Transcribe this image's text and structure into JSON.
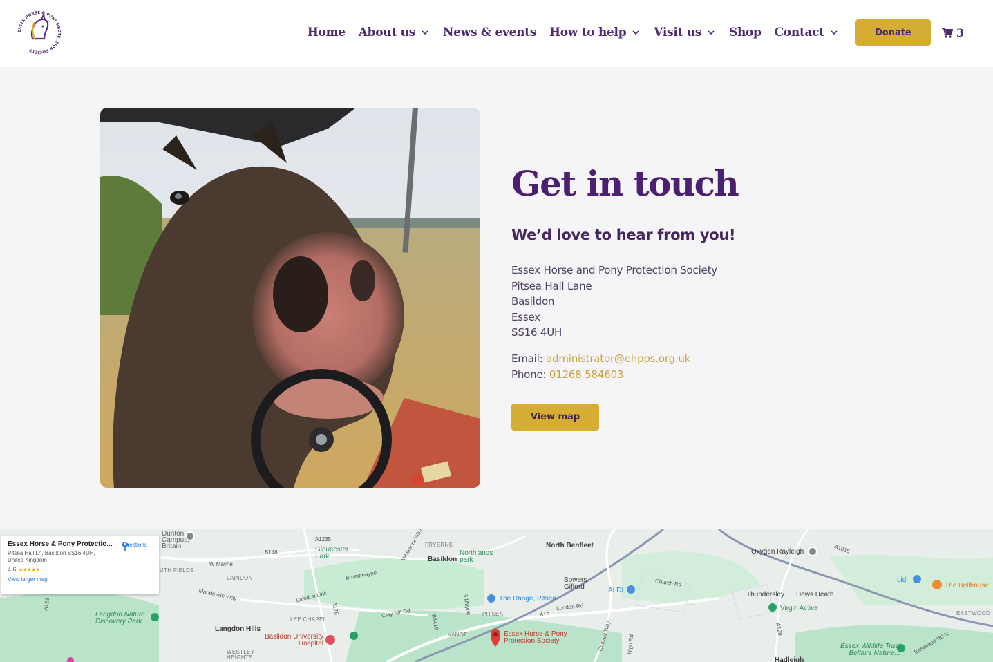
{
  "header": {
    "logo_text": "ESSEX HORSE & PONY PROTECTION SOCIETY",
    "nav": [
      {
        "label": "Home",
        "has_dropdown": false
      },
      {
        "label": "About us",
        "has_dropdown": true
      },
      {
        "label": "News & events",
        "has_dropdown": false
      },
      {
        "label": "How to help",
        "has_dropdown": true
      },
      {
        "label": "Visit us",
        "has_dropdown": true
      },
      {
        "label": "Shop",
        "has_dropdown": false
      },
      {
        "label": "Contact",
        "has_dropdown": true
      }
    ],
    "donate_label": "Donate",
    "cart_count": "3"
  },
  "contact": {
    "title": "Get in touch",
    "subtitle": "We’d love to hear from you!",
    "address": [
      "Essex Horse and Pony Protection Society",
      "Pitsea Hall Lane",
      "Basildon",
      "Essex",
      "SS16 4UH"
    ],
    "email_label": "Email:",
    "email": "administrator@ehpps.org.uk",
    "phone_label": "Phone:",
    "phone": "01268 584603",
    "map_button": "View map"
  },
  "map": {
    "card": {
      "title": "Essex Horse & Pony Protectio...",
      "address": "Pitsea Hall Ln, Basildon SS16 4UH, United Kingdom",
      "rating": "4.6",
      "stars": "★★★★★",
      "link": "View larger map",
      "directions": "Directions"
    },
    "places": {
      "north_benfleet": "North Benfleet",
      "basildon": "Basildon",
      "gloucester_park": "Gloucester Park",
      "northlands_park": "Northlands park",
      "bowers_gifford": "Bowers Gifford",
      "aldi": "ALDI",
      "the_range": "The Range, Pitsea",
      "thundersley": "Thundersley",
      "daws_heath": "Daws Heath",
      "virgin_active": "Virgin Active",
      "oxygen": "Oxygen Rayleigh",
      "lidl": "Lidl",
      "bellhouse": "The Bellhouse",
      "langdon_hills": "Langdon Hills",
      "langdon_nature": "Langdon Nature Discovery Park",
      "basildon_hospital": "Basildon University Hospital",
      "ehpps_pin": "Essex Horse & Pony Protection Society",
      "essex_wildlife": "Essex Wildlife Trust Belfairs Nature...",
      "dunton": "Dunton Campus, Britain",
      "laindon": "LAINDON",
      "fryerns": "FRYERNS",
      "pitsea": "PITSEA",
      "vange": "VANGE",
      "lee_chapel": "LEE CHAPEL",
      "eastwood": "EASTWOOD",
      "westley_heights": "WESTLEY HEIGHTS",
      "hadleigh": "Hadleigh",
      "south_fields": "UTH FIELDS"
    },
    "roads": {
      "a1235": "A1235",
      "b148": "B148",
      "w_mayne": "W Mayne",
      "broadmayne": "Broadmayne",
      "mandeville": "Mandeville Way",
      "laindon_link": "Laindon Link",
      "clay_hill": "Clay Hill Rd",
      "a176": "A176",
      "a13": "A13",
      "london_rd": "London Rd",
      "church_rd": "Church Rd",
      "a129": "A129",
      "a1015": "A1015",
      "a128": "A128",
      "eastwood_rd": "Eastwood Rd N",
      "whitmore": "Whitmore Way",
      "canvey": "Canvey Way",
      "high_rd": "High Rd",
      "s_mayne": "S Mayne",
      "b1419": "B1419"
    }
  }
}
